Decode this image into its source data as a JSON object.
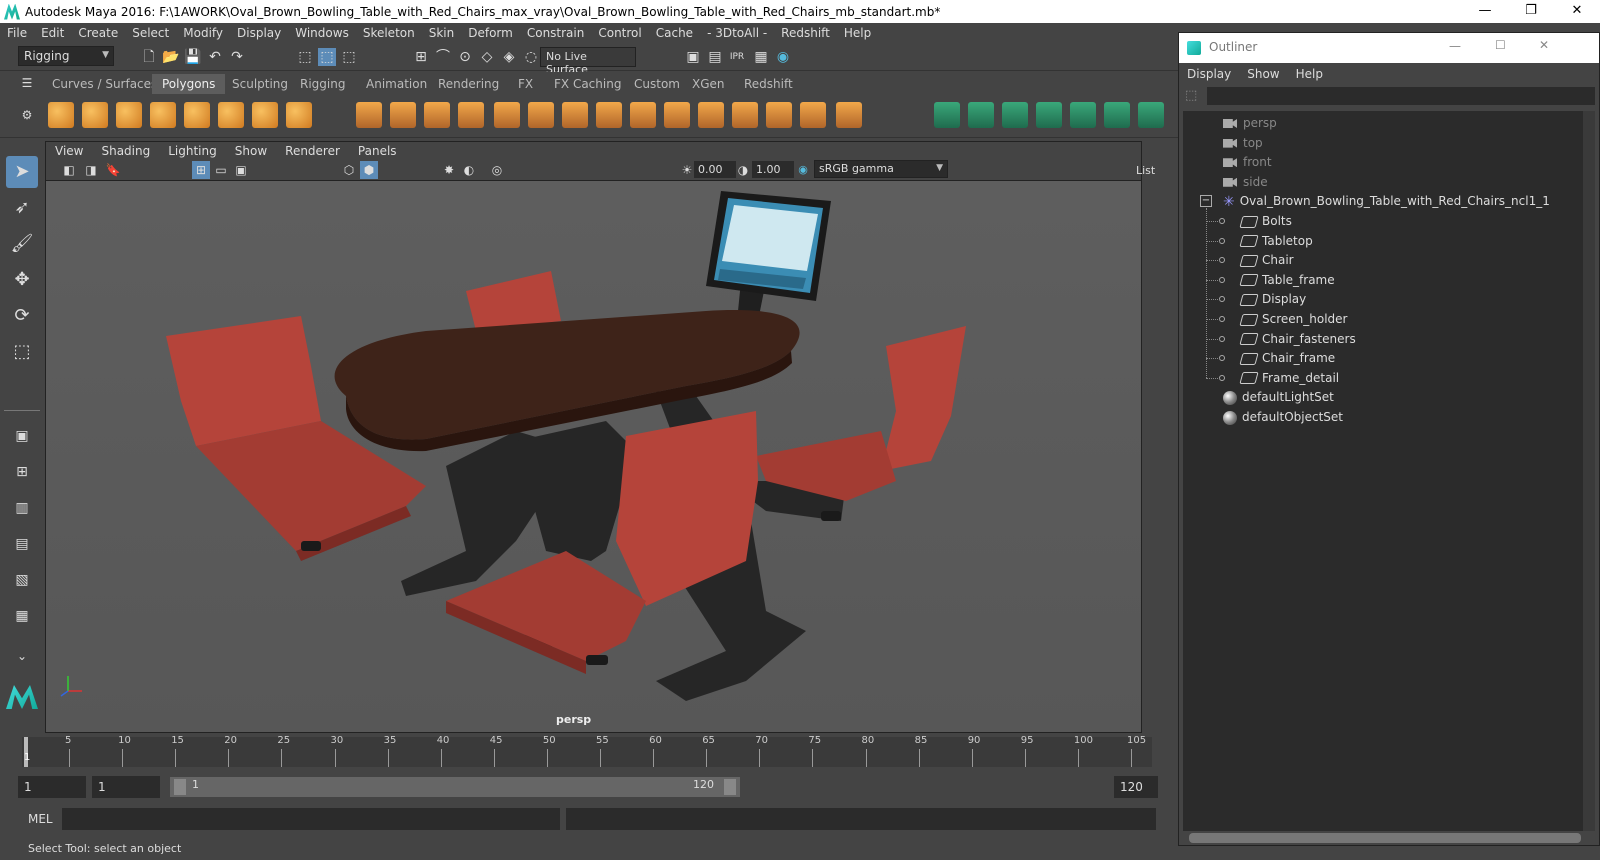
{
  "window": {
    "title": "Autodesk Maya 2016: F:\\1AWORK\\Oval_Brown_Bowling_Table_with_Red_Chairs_max_vray\\Oval_Brown_Bowling_Table_with_Red_Chairs_mb_standart.mb*",
    "minimize": "—",
    "maximize": "❐",
    "close": "✕"
  },
  "menubar": [
    "File",
    "Edit",
    "Create",
    "Select",
    "Modify",
    "Display",
    "Windows",
    "Skeleton",
    "Skin",
    "Deform",
    "Constrain",
    "Control",
    "Cache",
    "- 3DtoAll -",
    "Redshift",
    "Help"
  ],
  "status": {
    "mode": "Rigging",
    "live_surface": "No Live Surface"
  },
  "shelf_tabs": [
    "Curves / Surfaces",
    "Polygons",
    "Sculpting",
    "Rigging",
    "Animation",
    "Rendering",
    "FX",
    "FX Caching",
    "Custom",
    "XGen",
    "Redshift"
  ],
  "active_shelf_tab": "Polygons",
  "viewport": {
    "menu": [
      "View",
      "Shading",
      "Lighting",
      "Show",
      "Renderer",
      "Panels"
    ],
    "exposure": "0.00",
    "gamma": "1.00",
    "color_space": "sRGB gamma",
    "camera_label": "persp",
    "side_label": "List"
  },
  "timeline": {
    "ticks": [
      "5",
      "10",
      "15",
      "20",
      "25",
      "30",
      "35",
      "40",
      "45",
      "50",
      "55",
      "60",
      "65",
      "70",
      "75",
      "80",
      "85",
      "90",
      "95",
      "100",
      "105"
    ],
    "current": "1"
  },
  "range": {
    "start": "1",
    "anim_start": "1",
    "slider_start": "1",
    "slider_end": "120",
    "end": "120"
  },
  "cmd": {
    "label": "MEL"
  },
  "help": "Select Tool: select an object",
  "outliner": {
    "title": "Outliner",
    "menu": [
      "Display",
      "Show",
      "Help"
    ],
    "cameras": [
      "persp",
      "top",
      "front",
      "side"
    ],
    "group": "Oval_Brown_Bowling_Table_with_Red_Chairs_ncl1_1",
    "children": [
      "Bolts",
      "Tabletop",
      "Chair",
      "Table_frame",
      "Display",
      "Screen_holder",
      "Chair_fasteners",
      "Chair_frame",
      "Frame_detail"
    ],
    "sets": [
      "defaultLightSet",
      "defaultObjectSet"
    ]
  },
  "colors": {
    "chair": "#b5443a",
    "tabletop": "#3e2319",
    "frame": "#262626",
    "selection": "#5d8cb8"
  }
}
